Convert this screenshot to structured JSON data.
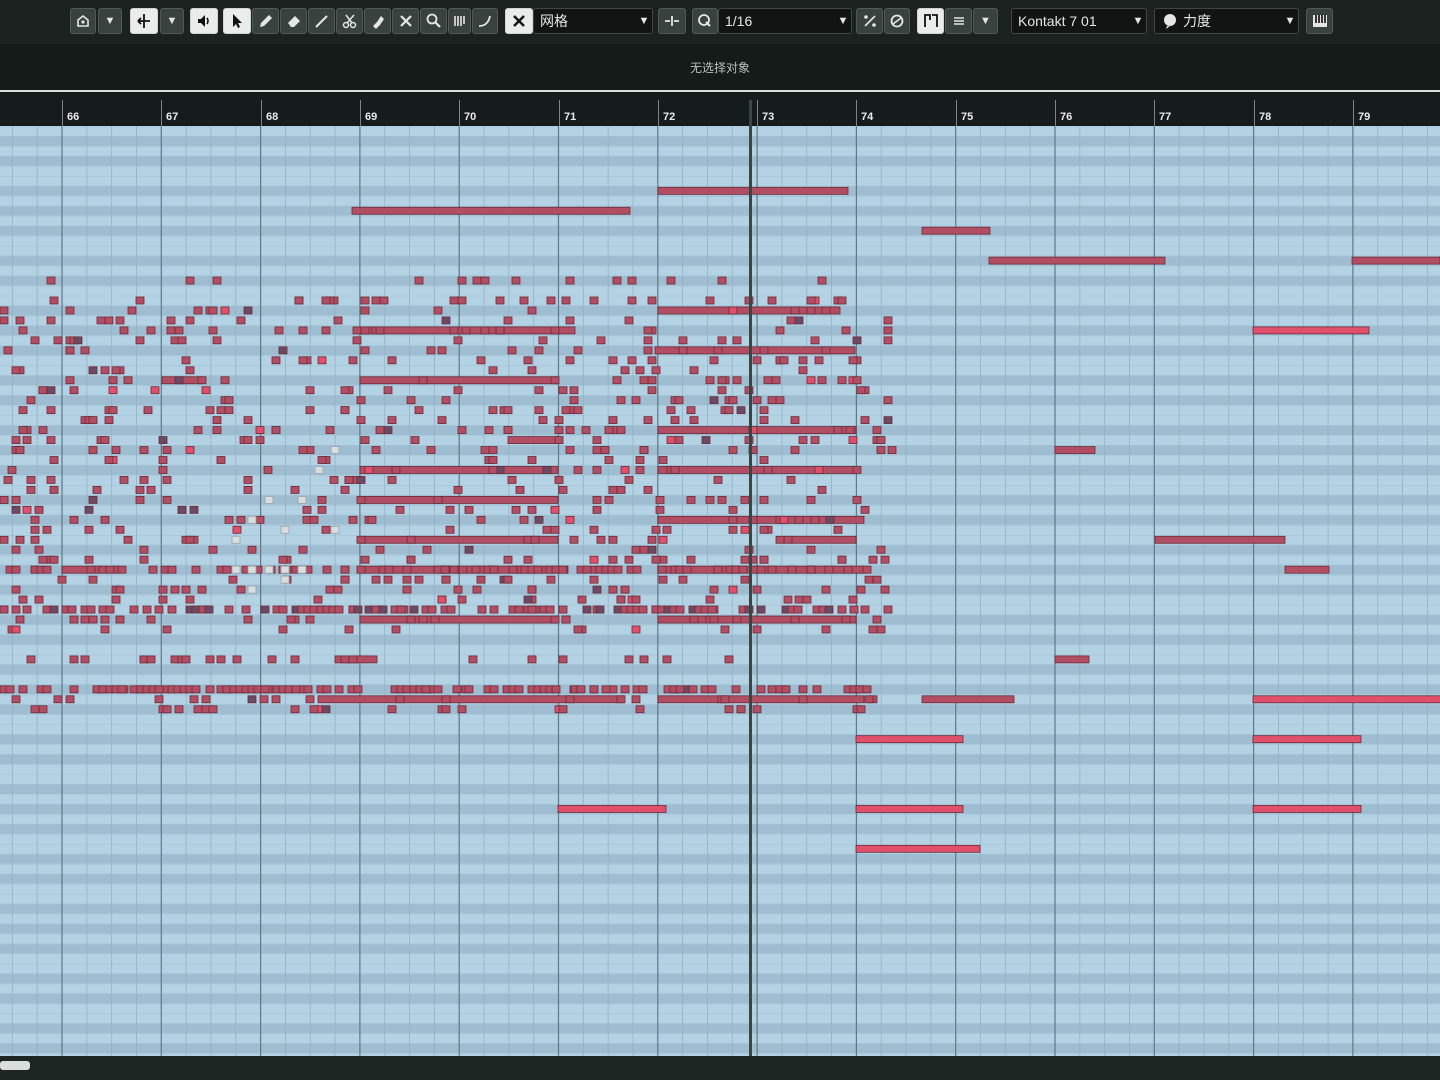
{
  "toolbar": {
    "snap_mode_label": "网格",
    "quantize_label": "1/16",
    "instrument_label": "Kontakt 7 01",
    "controller_label": "力度",
    "icons": [
      "context-menu-icon",
      "dropdown-icon",
      "transform-icon",
      "dropdown-icon",
      "audition-icon",
      "pointer-icon",
      "pencil-icon",
      "eraser-icon",
      "line-icon",
      "scissors-icon",
      "glue-icon",
      "mute-icon",
      "zoom-icon",
      "strum-icon",
      "curve-icon",
      "snap-icon",
      "insert-velocity-icon",
      "quantize-icon",
      "quantize-settings-icon",
      "color-icon",
      "length-icon",
      "stack-icon",
      "piano-keys-icon"
    ]
  },
  "infobar": {
    "status_text": "无选择对象"
  },
  "ruler": {
    "bars": [
      "66",
      "67",
      "68",
      "69",
      "70",
      "71",
      "72",
      "73",
      "74",
      "75",
      "76",
      "77",
      "78",
      "79"
    ]
  },
  "colors": {
    "note": "#b24e63",
    "note_selected": "#e0506a",
    "note_muted": "#d8dde0",
    "note_dark": "#6b4a63",
    "row_light": "#b3d2e4",
    "row_dark": "#9fbdd1",
    "bar_line": "#5f7885",
    "beat_line": "#93b1c4"
  }
}
